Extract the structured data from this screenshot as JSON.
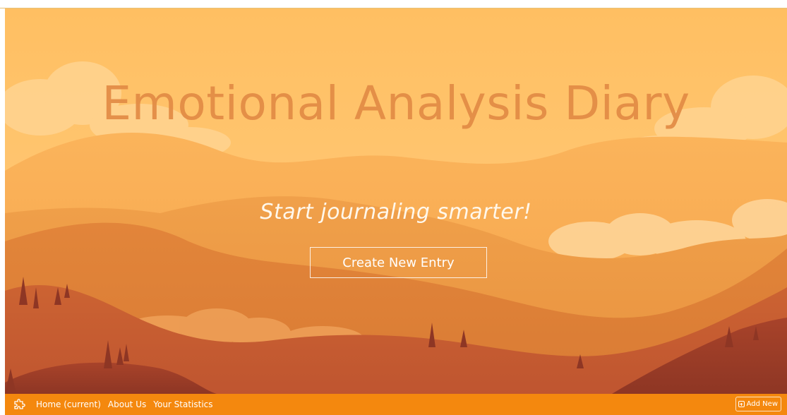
{
  "hero": {
    "title": "Emotional Analysis Diary",
    "tagline": "Start journaling smarter!",
    "cta_label": "Create New Entry"
  },
  "navbar": {
    "brand_icon": "puzzle-icon",
    "links": [
      {
        "label": "Home (current)",
        "active": true
      },
      {
        "label": "About Us",
        "active": false
      },
      {
        "label": "Your Statistics",
        "active": false
      }
    ],
    "add_new_label": "Add New",
    "add_new_icon": "plus-square-icon"
  },
  "colors": {
    "navbar": "#f4880e",
    "title": "#e28b45",
    "sky": "#ffc469"
  }
}
